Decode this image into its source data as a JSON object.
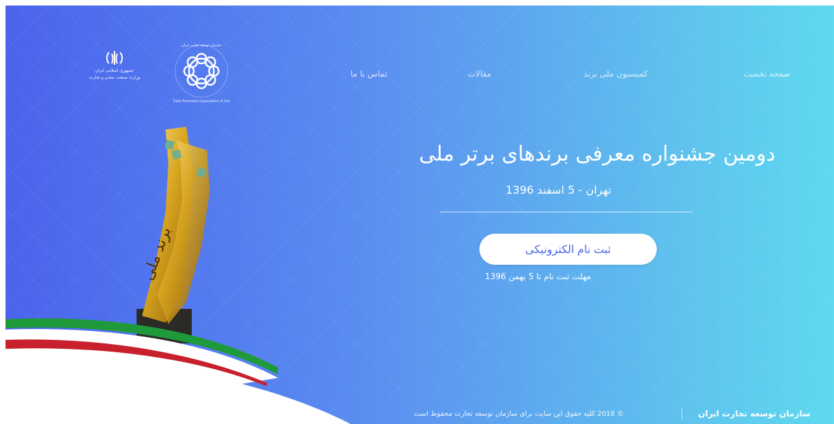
{
  "nav": {
    "home": "صفحه نخست",
    "commission": "کمیسیون ملی برند",
    "articles": "مقالات",
    "contact": "تماس با ما"
  },
  "hero": {
    "title": "دومین جشنواره معرفی برندهای برتر ملی",
    "subtitle": "تهران - 5 اسفند 1396",
    "register_button": "ثبت نام الکترونیکی",
    "deadline": "مهلت ثبت نام تا 5 بهمن 1396"
  },
  "logos": {
    "ministry_text_line1": "جمهوری اسلامی ایران",
    "ministry_text_line2": "وزارت صنعت، معدن و تجارت",
    "tpo_arc_text": "سازمان توسعه تجارت ایران",
    "tpo_arc_en": "Trade Promotion Organization of Iran"
  },
  "trophy": {
    "inscription": "برند ملی"
  },
  "footer": {
    "brand": "سازمان توسعه تجارت ایران",
    "copyright": "© 2018 کلیه حقوق این سایت برای سازمان توسعه تجارت محفوظ است"
  },
  "colors": {
    "gradient_start": "#4a63ec",
    "gradient_end": "#5ed9ee",
    "button_text": "#4a67e8",
    "flag_green": "#1f9a3a",
    "flag_red": "#c8202c"
  }
}
